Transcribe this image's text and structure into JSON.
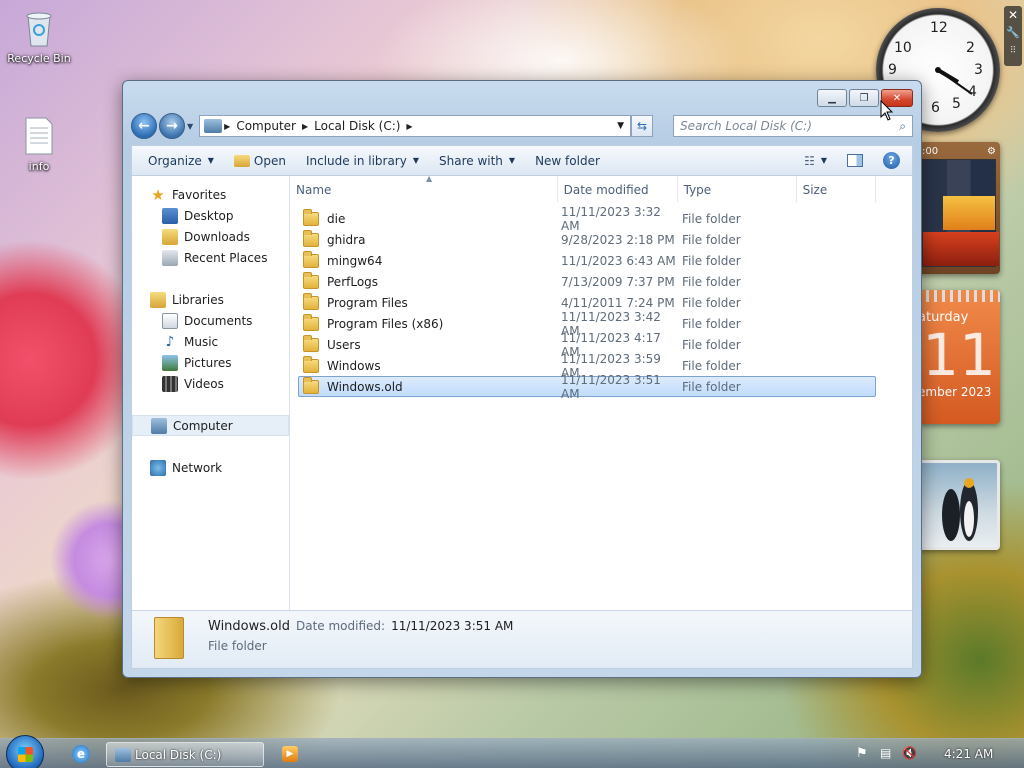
{
  "desktop": {
    "icons": [
      {
        "label": "Recycle Bin"
      },
      {
        "label": "info"
      }
    ]
  },
  "clock": {
    "numbers": [
      "12",
      "2",
      "3",
      "4",
      "5",
      "6",
      "9",
      "10"
    ]
  },
  "calendar": {
    "day_name": "aturday",
    "day_number": "11",
    "month_year": "ember 2023"
  },
  "puzzle": {
    "time": ":00"
  },
  "window": {
    "address": {
      "crumbs": [
        "Computer",
        "Local Disk (C:)"
      ]
    },
    "search": {
      "placeholder": "Search Local Disk (C:)"
    },
    "toolbar": {
      "organize": "Organize",
      "open": "Open",
      "include_in_library": "Include in library",
      "share_with": "Share with",
      "new_folder": "New folder"
    },
    "nav": {
      "favorites": "Favorites",
      "desktop": "Desktop",
      "downloads": "Downloads",
      "recent_places": "Recent Places",
      "libraries": "Libraries",
      "documents": "Documents",
      "music": "Music",
      "pictures": "Pictures",
      "videos": "Videos",
      "computer": "Computer",
      "network": "Network"
    },
    "columns": {
      "name": "Name",
      "date_modified": "Date modified",
      "type": "Type",
      "size": "Size"
    },
    "files": [
      {
        "name": "die",
        "date": "11/11/2023 3:32 AM",
        "type": "File folder"
      },
      {
        "name": "ghidra",
        "date": "9/28/2023 2:18 PM",
        "type": "File folder"
      },
      {
        "name": "mingw64",
        "date": "11/1/2023 6:43 AM",
        "type": "File folder"
      },
      {
        "name": "PerfLogs",
        "date": "7/13/2009 7:37 PM",
        "type": "File folder"
      },
      {
        "name": "Program Files",
        "date": "4/11/2011 7:24 PM",
        "type": "File folder"
      },
      {
        "name": "Program Files (x86)",
        "date": "11/11/2023 3:42 AM",
        "type": "File folder"
      },
      {
        "name": "Users",
        "date": "11/11/2023 4:17 AM",
        "type": "File folder"
      },
      {
        "name": "Windows",
        "date": "11/11/2023 3:59 AM",
        "type": "File folder"
      },
      {
        "name": "Windows.old",
        "date": "11/11/2023 3:51 AM",
        "type": "File folder"
      }
    ],
    "selected_index": 8,
    "details": {
      "name": "Windows.old",
      "date_label": "Date modified:",
      "date_value": "11/11/2023 3:51 AM",
      "type": "File folder"
    }
  },
  "taskbar": {
    "task_label": "Local Disk (C:)",
    "time": "4:21 AM"
  },
  "colors": {
    "selection": "#c1dcfc",
    "selection_border": "#7da2ce",
    "close_button": "#c63518",
    "accent": "#1e395b"
  }
}
